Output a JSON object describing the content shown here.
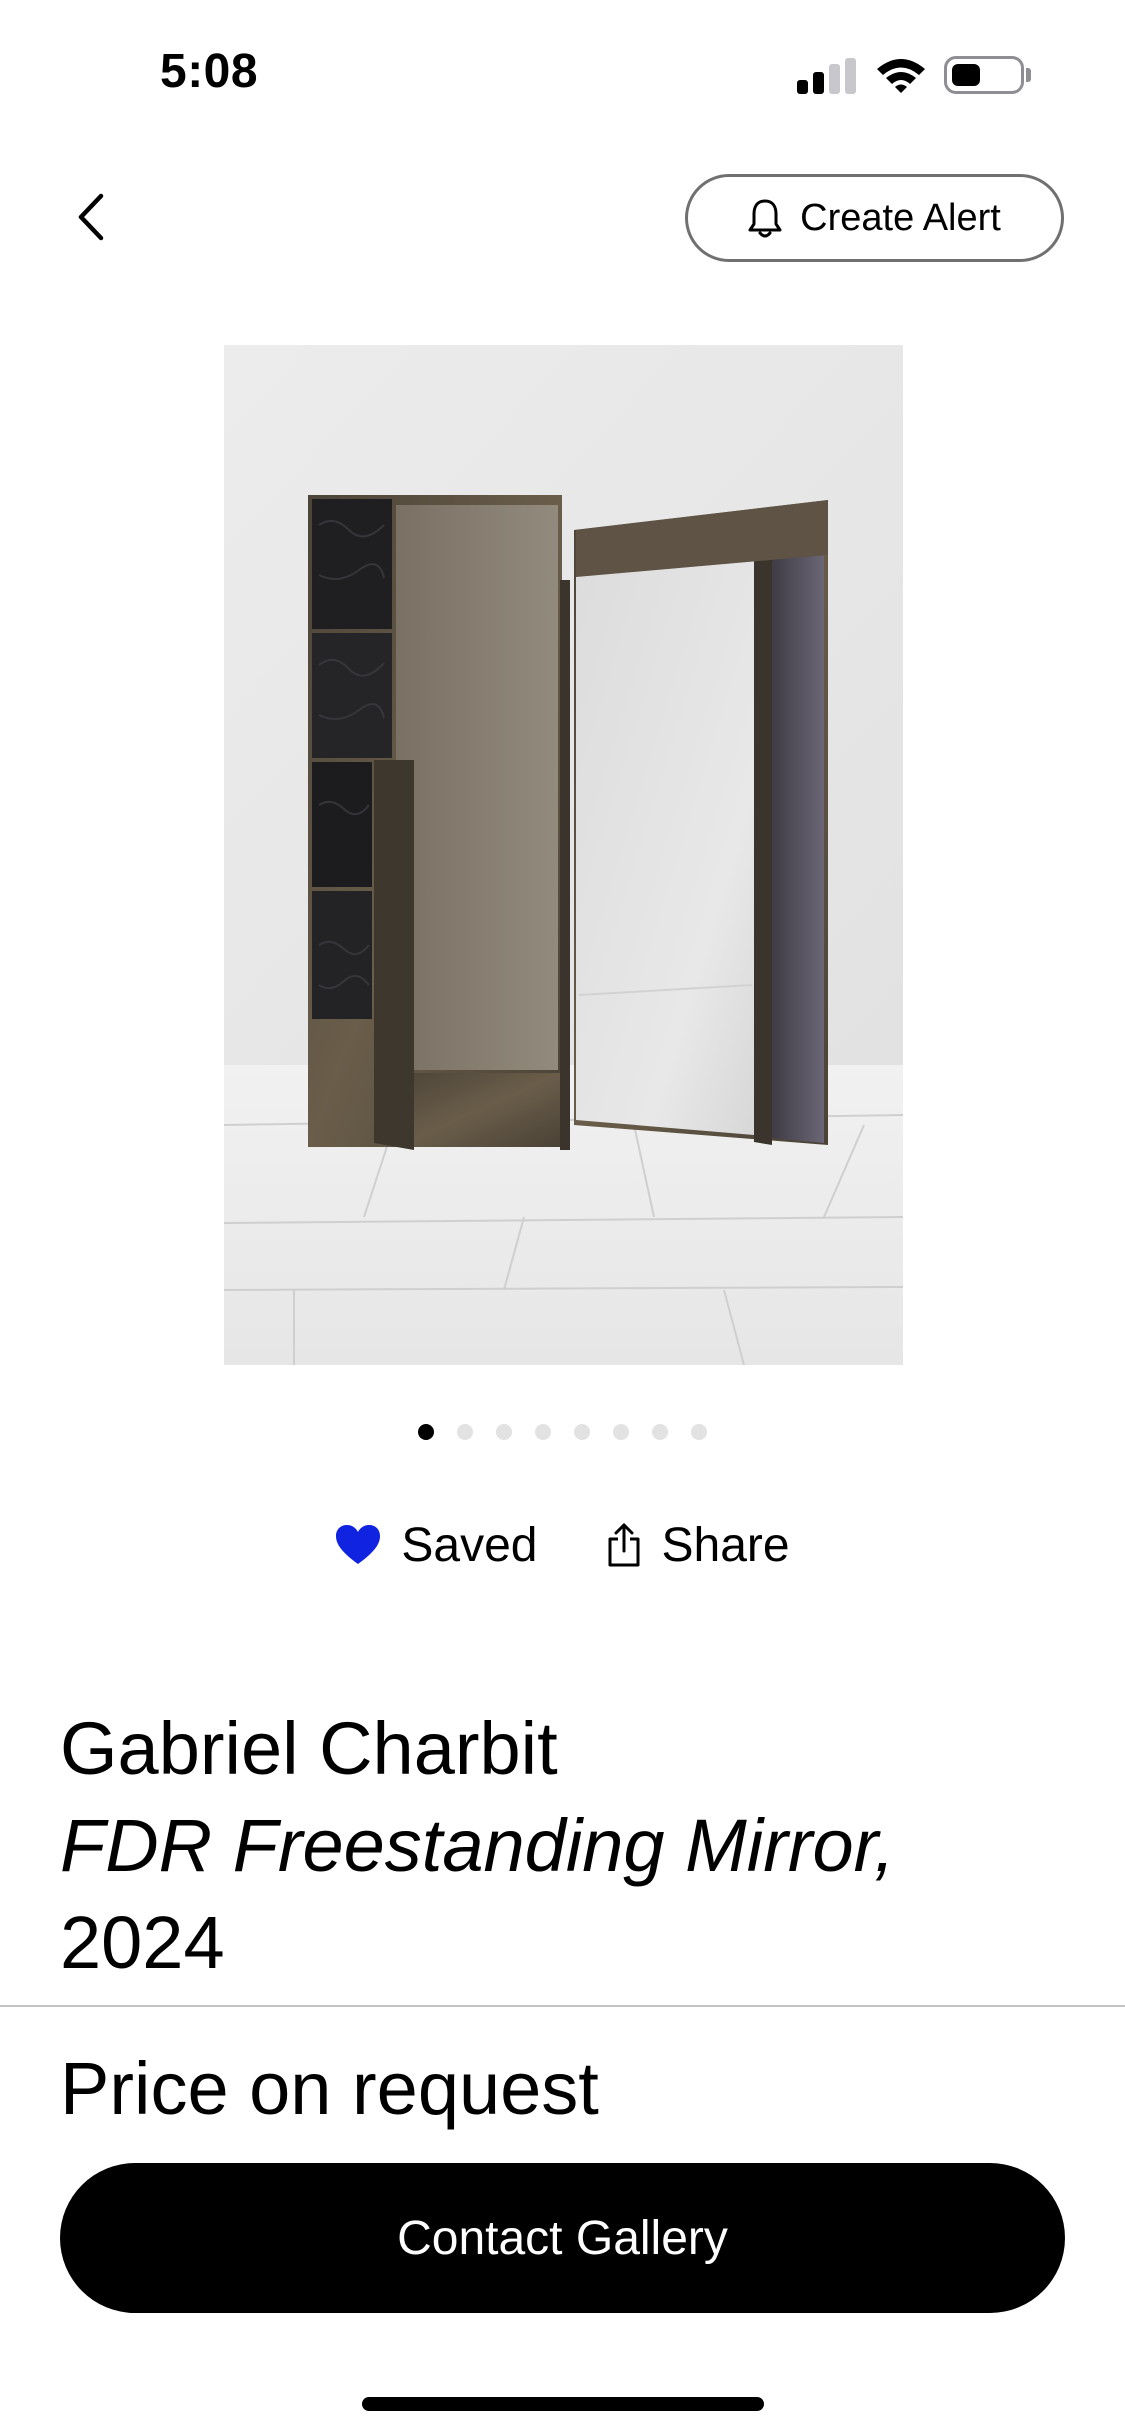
{
  "status_bar": {
    "time": "5:08"
  },
  "header": {
    "create_alert_label": "Create Alert"
  },
  "carousel": {
    "total_images": 8,
    "active_index": 0
  },
  "actions": {
    "saved_label": "Saved",
    "share_label": "Share",
    "saved_icon_color": "#1023e0"
  },
  "artwork": {
    "artist": "Gabriel Charbit",
    "title": "FDR Freestanding Mirror,",
    "year": "2024"
  },
  "commerce": {
    "price": "Price on request",
    "contact_label": "Contact Gallery"
  }
}
